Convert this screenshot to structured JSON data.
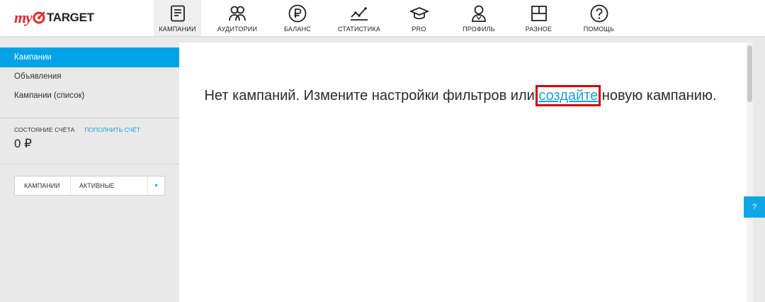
{
  "logo": {
    "my": "my",
    "target": "TARGET"
  },
  "nav": [
    {
      "label": "КАМПАНИИ",
      "icon": "campaigns-icon",
      "active": true
    },
    {
      "label": "АУДИТОРИИ",
      "icon": "audiences-icon"
    },
    {
      "label": "БАЛАНС",
      "icon": "ruble-icon"
    },
    {
      "label": "СТАТИСТИКА",
      "icon": "statistics-icon"
    },
    {
      "label": "PRO",
      "icon": "graduation-cap-icon"
    },
    {
      "label": "ПРОФИЛЬ",
      "icon": "profile-icon"
    },
    {
      "label": "РАЗНОЕ",
      "icon": "misc-icon"
    },
    {
      "label": "ПОМОЩЬ",
      "icon": "help-icon"
    }
  ],
  "sidebar": {
    "items": [
      {
        "label": "Кампании",
        "active": true
      },
      {
        "label": "Объявления"
      },
      {
        "label": "Кампании (список)"
      }
    ],
    "balance_label": "СОСТОЯНИЕ СЧЁТА",
    "balance_link": "ПОПОЛНИТЬ СЧЁТ",
    "balance_value": "0 ₽",
    "filter": {
      "type": "КАМПАНИИ",
      "status": "АКТИВНЫЕ",
      "arrow": "▼"
    }
  },
  "main": {
    "message_before": "Нет кампаний. Измените настройки фильтров или ",
    "create_link": "создайте",
    "message_after": " новую кампанию."
  },
  "help_tab": "?",
  "colors": {
    "accent": "#00a3e8",
    "brand_red": "#e8262a",
    "highlight": "#d10000"
  }
}
